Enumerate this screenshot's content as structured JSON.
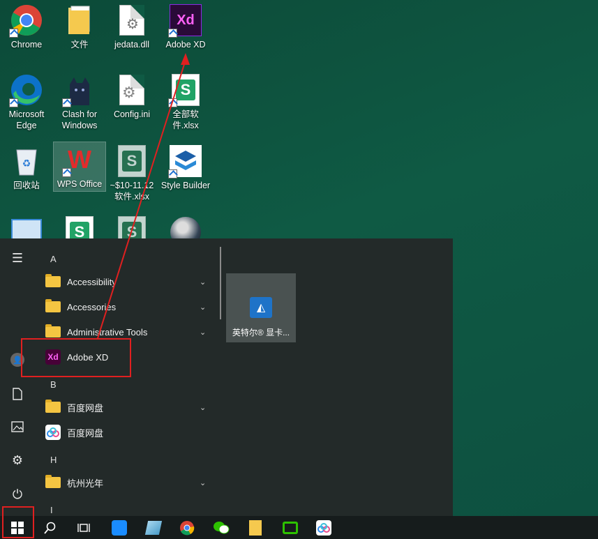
{
  "desktop": {
    "icons": [
      {
        "label": "Chrome"
      },
      {
        "label": "文件"
      },
      {
        "label": "jedata.dll"
      },
      {
        "label": "Adobe XD"
      },
      {
        "label": "Microsoft\nEdge"
      },
      {
        "label": "Clash for\nWindows"
      },
      {
        "label": "Config.ini"
      },
      {
        "label": "全部软件.xlsx"
      },
      {
        "label": "回收站"
      },
      {
        "label": "WPS Office"
      },
      {
        "label": "~$10-11.12\n软件.xlsx"
      },
      {
        "label": "Style Builder"
      }
    ]
  },
  "start_menu": {
    "letters": [
      "A",
      "B",
      "H",
      "I"
    ],
    "items": [
      {
        "label": "Accessibility",
        "type": "folder"
      },
      {
        "label": "Accessories",
        "type": "folder"
      },
      {
        "label": "Administrative Tools",
        "type": "folder"
      },
      {
        "label": "Adobe XD",
        "type": "app",
        "icon_text": "Xd"
      },
      {
        "label": "百度网盘",
        "type": "folder"
      },
      {
        "label": "百度网盘",
        "type": "app"
      },
      {
        "label": "杭州光年",
        "type": "folder"
      }
    ],
    "tile": {
      "label": "英特尔® 显卡..."
    }
  },
  "icons": {
    "xd_text": "Xd",
    "wps_text": "W",
    "xlsx_text": "S"
  },
  "colors": {
    "accent_red": "#e02020",
    "xd_bg": "#470137",
    "xd_fg": "#ff61f6"
  }
}
